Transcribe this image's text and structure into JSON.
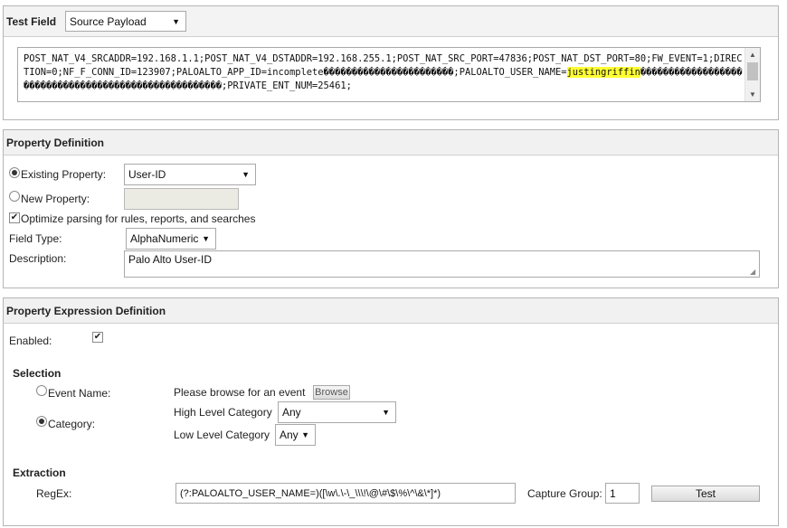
{
  "test_field": {
    "header": "Test Field",
    "select_value": "Source Payload",
    "payload_pre": "POST_NAT_V4_SRCADDR=192.168.1.1;POST_NAT_V4_DSTADDR=192.168.255.1;POST_NAT_SRC_PORT=47836;POST_NAT_DST_PORT=80;FW_EVENT=1;DIRECTION=0;NF_F_CONN_ID=123907;PALOALTO_APP_ID=incomplete�����������������������;PALOALTO_USER_NAME=",
    "payload_highlight": "justingriffin",
    "payload_post": "�����������������������������������������������������;PRIVATE_ENT_NUM=25461;"
  },
  "property_definition": {
    "header": "Property Definition",
    "existing_label": "Existing Property:",
    "existing_value": "User-ID",
    "new_label": "New Property:",
    "optimize_label": "Optimize parsing for rules, reports, and searches",
    "field_type_label": "Field Type:",
    "field_type_value": "AlphaNumeric",
    "description_label": "Description:",
    "description_value": "Palo Alto User-ID"
  },
  "expression_definition": {
    "header": "Property Expression Definition",
    "enabled_label": "Enabled:",
    "selection_title": "Selection",
    "event_name_label": "Event Name:",
    "browse_prompt": "Please browse for an event",
    "browse_button": "Browse",
    "category_label": "Category:",
    "high_level_label": "High Level Category",
    "high_level_value": "Any",
    "low_level_label": "Low Level Category",
    "low_level_value": "Any",
    "extraction_title": "Extraction",
    "regex_label": "RegEx:",
    "regex_value": "(?:PALOALTO_USER_NAME=)([\\w\\.\\-\\_\\\\\\!\\@\\#\\$\\%\\^\\&\\*]*)",
    "capture_group_label": "Capture Group:",
    "capture_group_value": "1",
    "test_button": "Test"
  }
}
